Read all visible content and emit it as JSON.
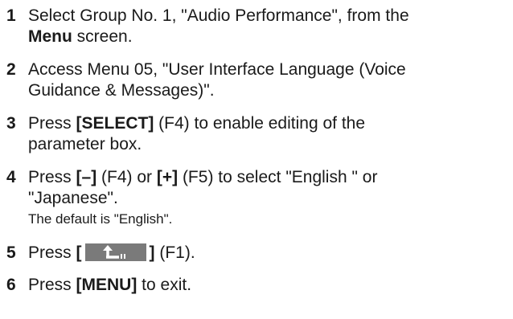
{
  "steps": [
    {
      "number": "1",
      "lines": [
        {
          "t1": "Select Group No. 1, \"Audio Performance\", from the"
        },
        {
          "bold": "Menu",
          "after": " screen."
        }
      ]
    },
    {
      "number": "2",
      "lines": [
        {
          "t1": "Access Menu 05, \"User Interface Language (Voice"
        },
        {
          "t1": "Guidance & Messages)\"."
        }
      ]
    },
    {
      "number": "3",
      "lines": [
        {
          "before": "Press ",
          "bold": "[SELECT]",
          "after": " (F4) to enable editing of the"
        },
        {
          "t1": "parameter box."
        }
      ]
    },
    {
      "number": "4",
      "line1": {
        "p1": "Press ",
        "k1": "[–]",
        "p2": " (F4) or ",
        "k2": "[+]",
        "p3": " (F5) to select \"English \" or"
      },
      "line2": "\"Japanese\".",
      "note": "The default is \"English\"."
    },
    {
      "number": "5",
      "before": "Press ",
      "open": "[",
      "icon": "return-arrow-icon",
      "close": "]",
      "after": " (F1)."
    },
    {
      "number": "6",
      "before": "Press ",
      "bold": "[MENU]",
      "after": " to exit."
    }
  ]
}
